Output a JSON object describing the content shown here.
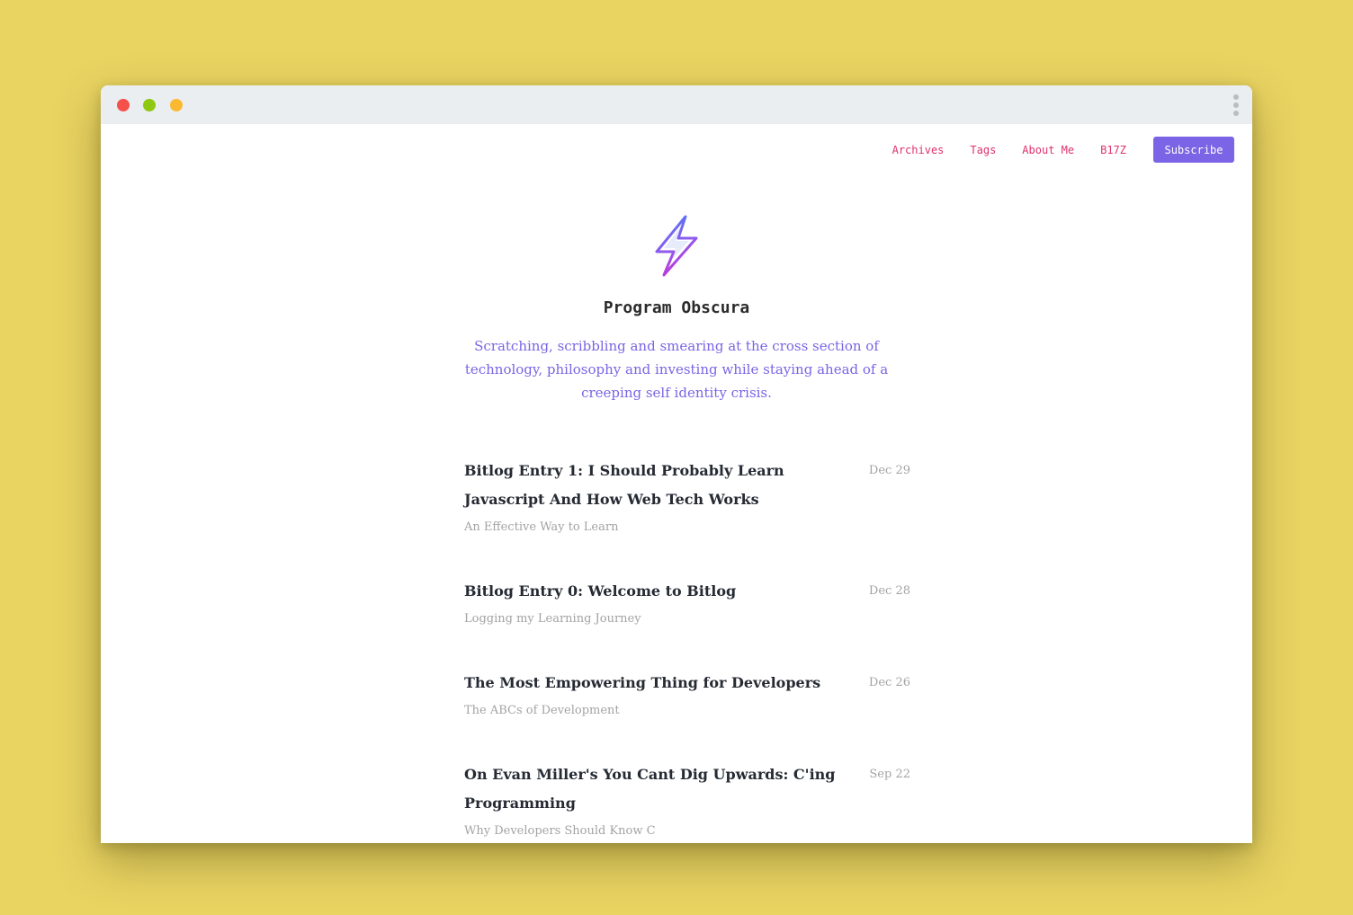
{
  "nav": {
    "items": [
      {
        "label": "Archives"
      },
      {
        "label": "Tags"
      },
      {
        "label": "About Me"
      },
      {
        "label": "B17Z"
      }
    ],
    "subscribe_label": "Subscribe"
  },
  "site": {
    "logo_icon": "lightning-bolt-icon",
    "title": "Program Obscura",
    "tagline": "Scratching, scribbling and smearing at the cross section of technology, philosophy and investing while staying ahead of a creeping self identity crisis."
  },
  "posts": [
    {
      "title": "Bitlog Entry 1: I Should Probably Learn Javascript And How Web Tech Works",
      "date": "Dec 29",
      "subtitle": "An Effective Way to Learn"
    },
    {
      "title": "Bitlog Entry 0: Welcome to Bitlog",
      "date": "Dec 28",
      "subtitle": "Logging my Learning Journey"
    },
    {
      "title": "The Most Empowering Thing for Developers",
      "date": "Dec 26",
      "subtitle": "The ABCs of Development"
    },
    {
      "title": "On Evan Miller's You Cant Dig Upwards: C'ing Programming",
      "date": "Sep 22",
      "subtitle": "Why Developers Should Know C"
    }
  ],
  "colors": {
    "background": "#e9d462",
    "accent_purple": "#7b64e5",
    "nav_link": "#e0326c",
    "post_title": "#252a33",
    "muted": "#a3a3a3"
  }
}
